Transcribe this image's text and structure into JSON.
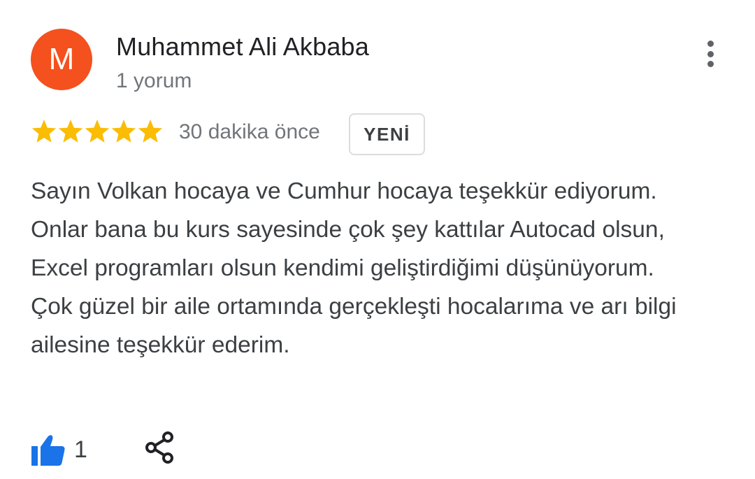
{
  "reviewer": {
    "avatar_initial": "M",
    "avatar_color": "#f4511e",
    "name": "Muhammet Ali Akbaba",
    "review_count": "1 yorum"
  },
  "rating": {
    "stars": 5,
    "max_stars": 5,
    "star_color": "#fbbc04",
    "icon": "star-icon"
  },
  "meta": {
    "date": "30 dakika önce",
    "badge": "YENİ"
  },
  "review_text": "Sayın Volkan hocaya ve Cumhur hocaya teşekkür ediyorum. Onlar bana bu kurs sayesinde çok şey kattılar Autocad olsun, Excel programları olsun kendimi geliştirdiğimi düşünüyorum. Çok güzel bir aile ortamında gerçekleşti hocalarıma ve arı bilgi ailesine teşekkür ederim.",
  "actions": {
    "like_count": "1",
    "like_icon": "thumbs-up-icon",
    "like_color": "#1a73e8",
    "share_icon": "share-icon",
    "more_icon": "more-vert-icon"
  }
}
